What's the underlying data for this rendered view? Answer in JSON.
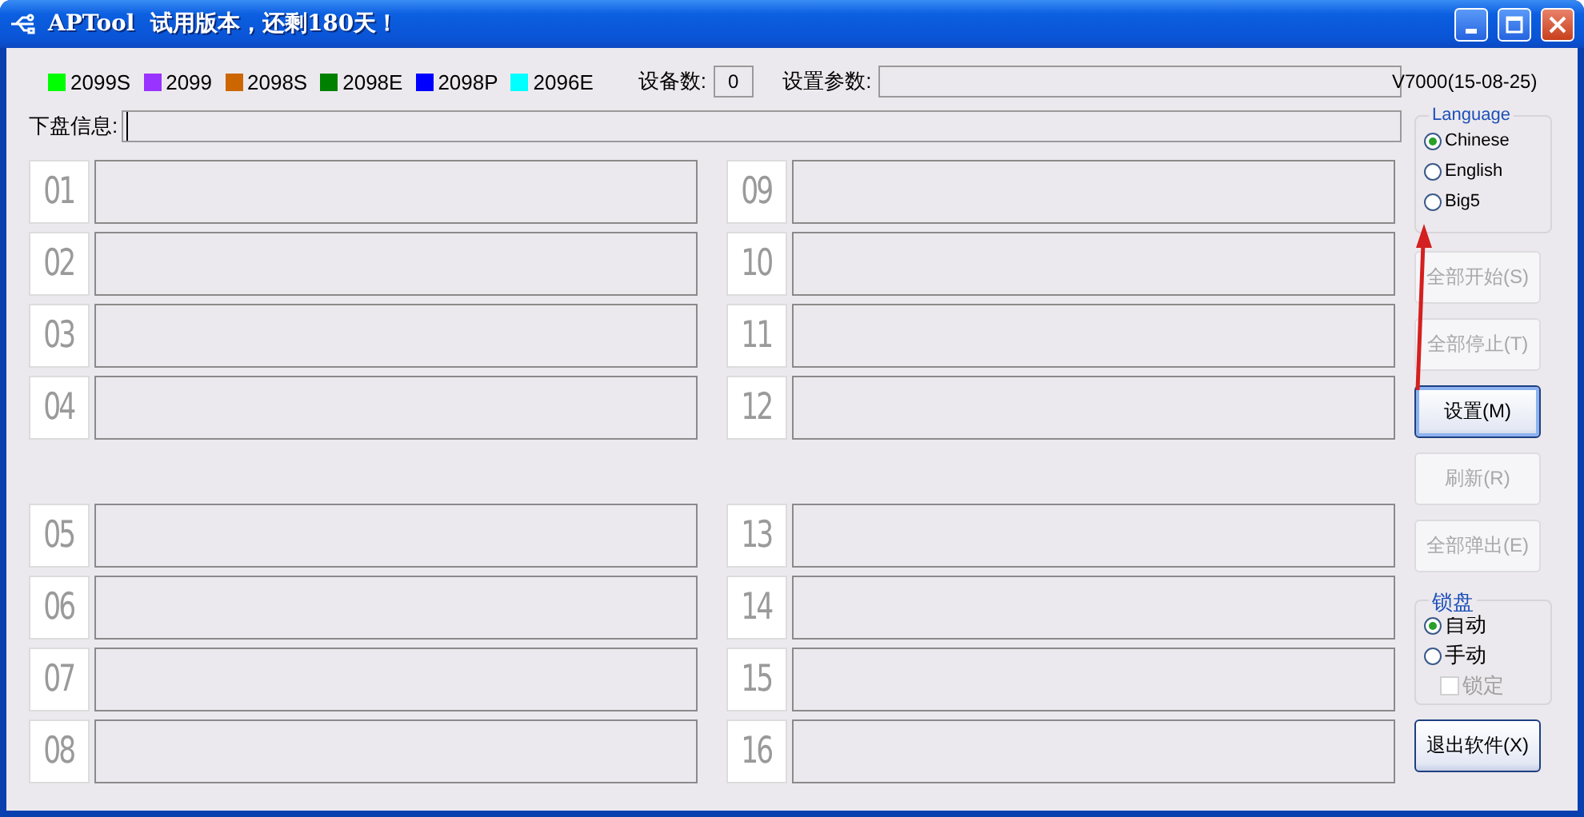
{
  "window": {
    "title": "APTool  试用版本，还剩180天！"
  },
  "legend": [
    {
      "label": "2099S",
      "color": "#00ff00"
    },
    {
      "label": "2099",
      "color": "#9933ff"
    },
    {
      "label": "2098S",
      "color": "#cc6600"
    },
    {
      "label": "2098E",
      "color": "#008000"
    },
    {
      "label": "2098P",
      "color": "#0000ff"
    },
    {
      "label": "2096E",
      "color": "#00ffff"
    }
  ],
  "device_count": {
    "label": "设备数:",
    "value": "0"
  },
  "settings_params": {
    "label": "设置参数:"
  },
  "version": "V7000(15-08-25)",
  "disk_info": {
    "label": "下盘信息:"
  },
  "slot_columns": [
    [
      "01",
      "02",
      "03",
      "04",
      "05",
      "06",
      "07",
      "08"
    ],
    [
      "09",
      "10",
      "11",
      "12",
      "13",
      "14",
      "15",
      "16"
    ]
  ],
  "language": {
    "title": "Language",
    "options": [
      {
        "label": "Chinese",
        "selected": true
      },
      {
        "label": "English",
        "selected": false
      },
      {
        "label": "Big5",
        "selected": false
      }
    ]
  },
  "buttons": [
    {
      "label": "全部开始(S)",
      "disabled": true,
      "default": false
    },
    {
      "label": "全部停止(T)",
      "disabled": true,
      "default": false
    },
    {
      "label": "设置(M)",
      "disabled": false,
      "default": true
    },
    {
      "label": "刷新(R)",
      "disabled": true,
      "default": false
    },
    {
      "label": "全部弹出(E)",
      "disabled": true,
      "default": false
    }
  ],
  "lock": {
    "title": "锁盘",
    "options": [
      {
        "label": "自动",
        "selected": true
      },
      {
        "label": "手动",
        "selected": false
      }
    ],
    "checkbox": {
      "label": "锁定",
      "checked": false,
      "disabled": true
    }
  },
  "exit_button": {
    "label": "退出软件(X)",
    "disabled": false,
    "default": false
  }
}
